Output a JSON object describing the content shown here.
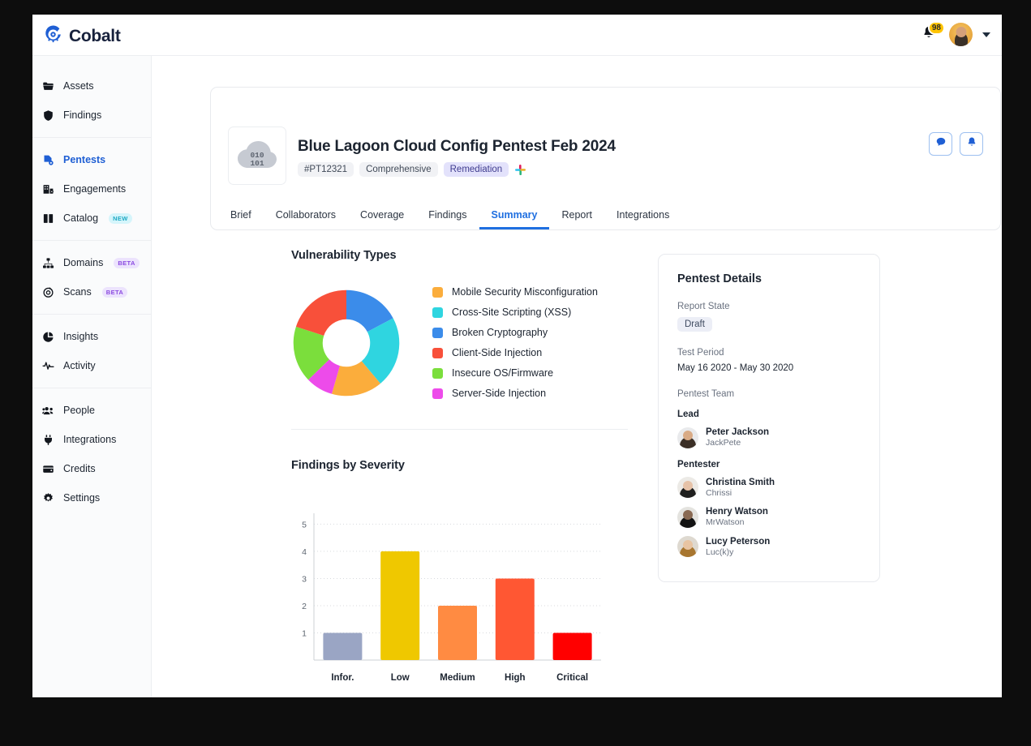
{
  "brand": {
    "name": "Cobalt",
    "accent": "#1f5fd4",
    "logo_icon": "cobalt-c-logo"
  },
  "topbar": {
    "notifications_icon": "bell-icon",
    "notifications_count": "98",
    "avatar_icon": "user-avatar",
    "caret_icon": "chevron-down-icon"
  },
  "sidebar": {
    "groups": [
      {
        "items": [
          {
            "label": "Assets",
            "icon": "folder-icon",
            "active": false,
            "badge": ""
          },
          {
            "label": "Findings",
            "icon": "shield-icon",
            "active": false,
            "badge": ""
          }
        ]
      },
      {
        "items": [
          {
            "label": "Pentests",
            "icon": "pentest-icon",
            "active": true,
            "badge": ""
          },
          {
            "label": "Engagements",
            "icon": "building-icon",
            "active": false,
            "badge": ""
          },
          {
            "label": "Catalog",
            "icon": "book-icon",
            "active": false,
            "badge": "NEW"
          }
        ]
      },
      {
        "items": [
          {
            "label": "Domains",
            "icon": "sitemap-icon",
            "active": false,
            "badge": "BETA"
          },
          {
            "label": "Scans",
            "icon": "target-icon",
            "active": false,
            "badge": "BETA"
          }
        ]
      },
      {
        "items": [
          {
            "label": "Insights",
            "icon": "pie-chart-icon",
            "active": false,
            "badge": ""
          },
          {
            "label": "Activity",
            "icon": "pulse-icon",
            "active": false,
            "badge": ""
          }
        ]
      },
      {
        "items": [
          {
            "label": "People",
            "icon": "people-icon",
            "active": false,
            "badge": ""
          },
          {
            "label": "Integrations",
            "icon": "plug-icon",
            "active": false,
            "badge": ""
          },
          {
            "label": "Credits",
            "icon": "wallet-icon",
            "active": false,
            "badge": ""
          },
          {
            "label": "Settings",
            "icon": "gear-icon",
            "active": false,
            "badge": ""
          }
        ]
      }
    ]
  },
  "pentest_header": {
    "thumbnail_icon": "cloud-binary-icon",
    "thumbnail_text_line1": "010",
    "thumbnail_text_line2": "101",
    "title": "Blue Lagoon Cloud Config Pentest Feb 2024",
    "id_badge": "#PT12321",
    "type_badge": "Comprehensive",
    "state_badge": "Remediation",
    "slack_icon": "slack-icon",
    "actions": [
      {
        "icon": "comment-icon",
        "name": "comments-button"
      },
      {
        "icon": "bell-icon",
        "name": "notifications-button"
      }
    ]
  },
  "tabs": [
    {
      "label": "Brief",
      "active": false
    },
    {
      "label": "Collaborators",
      "active": false
    },
    {
      "label": "Coverage",
      "active": false
    },
    {
      "label": "Findings",
      "active": false
    },
    {
      "label": "Summary",
      "active": true
    },
    {
      "label": "Report",
      "active": false
    },
    {
      "label": "Integrations",
      "active": false
    }
  ],
  "details": {
    "title": "Pentest Details",
    "report_state_label": "Report State",
    "report_state_value": "Draft",
    "test_period_label": "Test Period",
    "test_period_value": "May 16 2020 - May 30 2020",
    "team_label": "Pentest Team",
    "lead_label": "Lead",
    "pentester_label": "Pentester",
    "lead": [
      {
        "name": "Peter Jackson",
        "handle": "JackPete",
        "skin": "#d9ab86",
        "hair": "#3b2f26",
        "bg": "#e9eaec"
      }
    ],
    "pentesters": [
      {
        "name": "Christina Smith",
        "handle": "Chrissi",
        "skin": "#e6c2a8",
        "hair": "#20201f",
        "bg": "#eceae6"
      },
      {
        "name": "Henry Watson",
        "handle": "MrWatson",
        "skin": "#8a6a53",
        "hair": "#131313",
        "bg": "#e4e3df"
      },
      {
        "name": "Lucy Peterson",
        "handle": "Luc(k)y",
        "skin": "#e8c4a2",
        "hair": "#a8762f",
        "bg": "#ded9d0"
      }
    ]
  },
  "chart_data": [
    {
      "type": "pie",
      "title": "Vulnerability Types",
      "donut": true,
      "legend_position": "right",
      "categories": [
        "Mobile Security Misconfiguration",
        "Cross-Site Scripting (XSS)",
        "Broken Cryptography",
        "Client-Side Injection",
        "Insecure OS/Firmware",
        "Server-Side Injection"
      ],
      "values": [
        56,
        78,
        62,
        72,
        62,
        30
      ],
      "units": "degrees",
      "colors": [
        "#FBAD3C",
        "#2FD5E0",
        "#3B8CEA",
        "#F8503A",
        "#7BDE3C",
        "#ED4BEA"
      ],
      "draw_order": [
        "Broken Cryptography",
        "Cross-Site Scripting (XSS)",
        "Mobile Security Misconfiguration",
        "Server-Side Injection",
        "Insecure OS/Firmware",
        "Client-Side Injection"
      ]
    },
    {
      "type": "bar",
      "title": "Findings by Severity",
      "categories": [
        "Infor.",
        "Low",
        "Medium",
        "High",
        "Critical"
      ],
      "values": [
        1,
        4,
        2,
        3,
        1
      ],
      "colors": [
        "#9AA5C4",
        "#EFC800",
        "#FF8B42",
        "#FF5733",
        "#FF0000"
      ],
      "xlabel": "",
      "ylabel": "",
      "ylim": [
        0,
        5.4
      ],
      "yticks": [
        1,
        2,
        3,
        4,
        5
      ],
      "grid": true
    }
  ]
}
